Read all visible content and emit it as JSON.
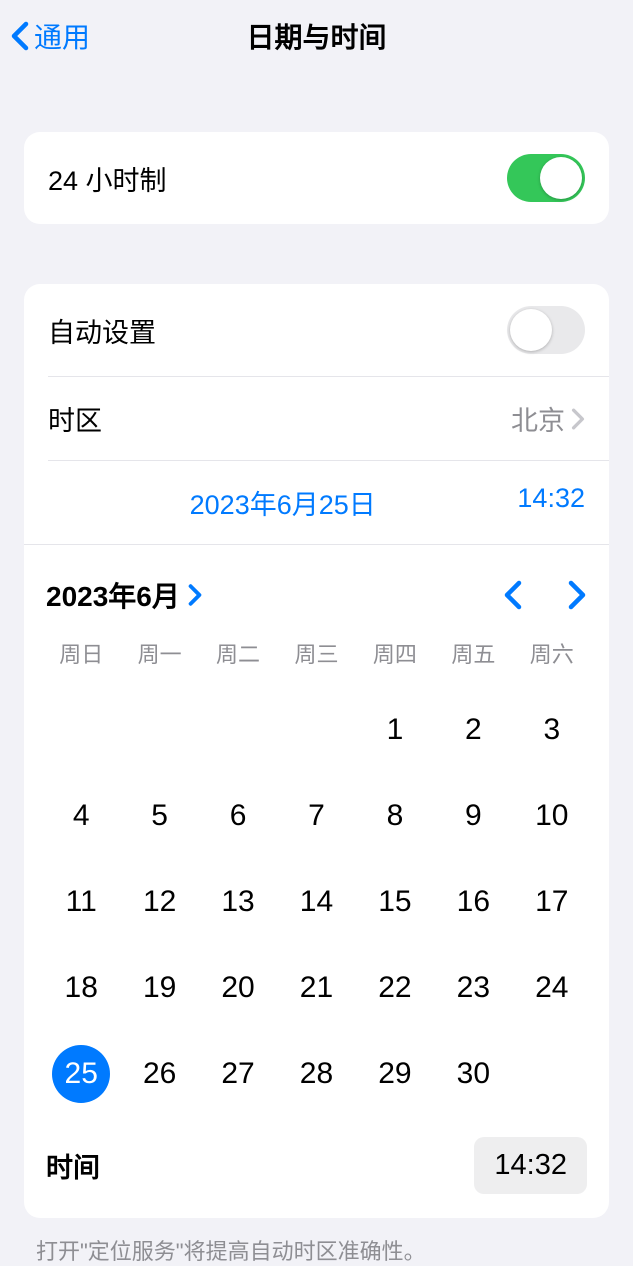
{
  "nav": {
    "back": "通用",
    "title": "日期与时间"
  },
  "toggle24": {
    "label": "24 小时制",
    "state": "on"
  },
  "autoSet": {
    "label": "自动设置",
    "state": "off"
  },
  "timezone": {
    "label": "时区",
    "value": "北京"
  },
  "selected": {
    "date": "2023年6月25日",
    "time": "14:32"
  },
  "calendar": {
    "month": "2023年6月",
    "weekdays": [
      "周日",
      "周一",
      "周二",
      "周三",
      "周四",
      "周五",
      "周六"
    ],
    "startOffset": 4,
    "daysInMonth": 30,
    "selectedDay": 25,
    "timeLabel": "时间",
    "timeValue": "14:32"
  },
  "footer": "打开\"定位服务\"将提高自动时区准确性。"
}
